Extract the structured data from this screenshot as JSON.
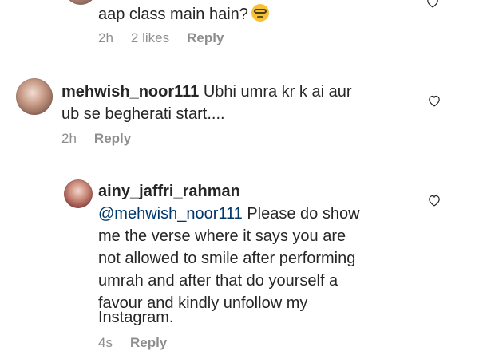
{
  "comments": [
    {
      "text": "aap class main hain?",
      "emoji": "nerd-face",
      "meta": {
        "time": "2h",
        "likes": "2 likes",
        "reply": "Reply"
      }
    },
    {
      "username": "mehwish_noor111",
      "text_line1": "Ubhi umra kr k ai aur",
      "text_line2": "ub se begherati start....",
      "meta": {
        "time": "2h",
        "reply": "Reply"
      }
    },
    {
      "username": "ainy_jaffri_rahman",
      "mention": "@mehwish_noor111",
      "line1": "Please do show",
      "line2": "me the verse where it says you are",
      "line3": "not allowed to smile after performing",
      "line4": "umrah and after that do yourself a",
      "line5": "favour and kindly unfollow my",
      "line6": "Instagram.",
      "meta": {
        "time": "4s",
        "reply": "Reply"
      }
    }
  ],
  "colors": {
    "text": "#262626",
    "meta": "#8e8e8e",
    "mention": "#00376b"
  },
  "icons": {
    "like": "heart-outline-icon"
  }
}
